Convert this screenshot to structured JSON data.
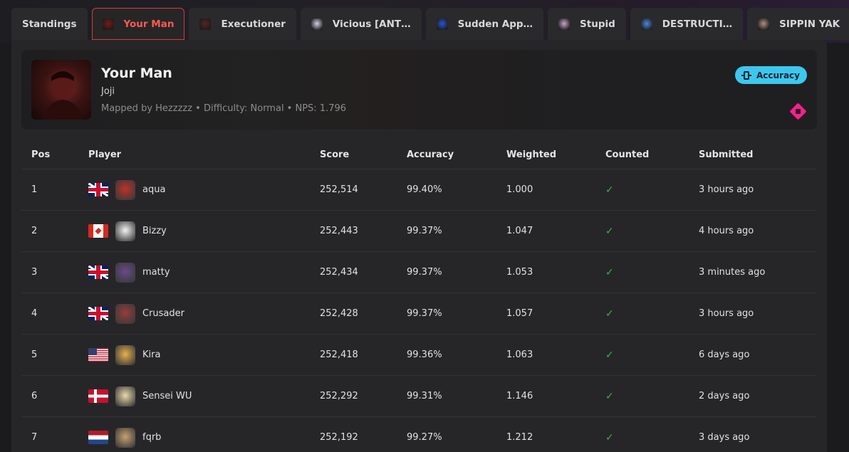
{
  "tabs": [
    {
      "label": "Standings",
      "active": false,
      "icon": null
    },
    {
      "label": "Your Man",
      "active": true,
      "icon": "your-man-cover-icon",
      "color": "#7a1a1a"
    },
    {
      "label": "Executioner",
      "active": false,
      "icon": "executioner-cover-icon",
      "color": "#5a2222"
    },
    {
      "label": "Vicious [ANT…",
      "active": false,
      "icon": "vicious-cover-icon",
      "color": "#cfcfe0"
    },
    {
      "label": "Sudden App…",
      "active": false,
      "icon": "sudden-cover-icon",
      "color": "#2a55c8"
    },
    {
      "label": "Stupid",
      "active": false,
      "icon": "stupid-cover-icon",
      "color": "#c9a3c9"
    },
    {
      "label": "DESTRUCTI…",
      "active": false,
      "icon": "destruction-cover-icon",
      "color": "#4a8ad8"
    },
    {
      "label": "SIPPIN YAK",
      "active": false,
      "icon": "sippin-yak-cover-icon",
      "color": "#b0907a"
    }
  ],
  "song": {
    "title": "Your Man",
    "artist": "Joji",
    "meta": "Mapped by Hezzzzz • Difficulty: Normal • NPS: 1.796",
    "badge_label": "Accuracy",
    "badge_color": "#3ec7ee",
    "diamond_color": "#ff1f8c"
  },
  "table": {
    "headers": {
      "pos": "Pos",
      "player": "Player",
      "score": "Score",
      "accuracy": "Accuracy",
      "weighted": "Weighted",
      "counted": "Counted",
      "submitted": "Submitted"
    },
    "rows": [
      {
        "pos": "1",
        "flag": "gb",
        "avatar_color": "#c03028",
        "player": "aqua",
        "score": "252,514",
        "accuracy": "99.40%",
        "weighted": "1.000",
        "counted": "✓",
        "submitted": "3 hours ago"
      },
      {
        "pos": "2",
        "flag": "ca",
        "avatar_color": "#f2f2f2",
        "player": "Bizzy",
        "score": "252,443",
        "accuracy": "99.37%",
        "weighted": "1.047",
        "counted": "✓",
        "submitted": "4 hours ago"
      },
      {
        "pos": "3",
        "flag": "gb",
        "avatar_color": "#6a4a8a",
        "player": "matty",
        "score": "252,434",
        "accuracy": "99.37%",
        "weighted": "1.053",
        "counted": "✓",
        "submitted": "3 minutes ago"
      },
      {
        "pos": "4",
        "flag": "gb",
        "avatar_color": "#9a3a3a",
        "player": "Crusader",
        "score": "252,428",
        "accuracy": "99.37%",
        "weighted": "1.057",
        "counted": "✓",
        "submitted": "3 hours ago"
      },
      {
        "pos": "5",
        "flag": "us",
        "avatar_color": "#e8b04a",
        "player": "Kira",
        "score": "252,418",
        "accuracy": "99.36%",
        "weighted": "1.063",
        "counted": "✓",
        "submitted": "6 days ago"
      },
      {
        "pos": "6",
        "flag": "dk",
        "avatar_color": "#e8d8a8",
        "player": "Sensei WU",
        "score": "252,292",
        "accuracy": "99.31%",
        "weighted": "1.146",
        "counted": "✓",
        "submitted": "2 days ago"
      },
      {
        "pos": "7",
        "flag": "nl",
        "avatar_color": "#c8a070",
        "player": "fqrb",
        "score": "252,192",
        "accuracy": "99.27%",
        "weighted": "1.212",
        "counted": "✓",
        "submitted": "3 days ago"
      }
    ]
  }
}
